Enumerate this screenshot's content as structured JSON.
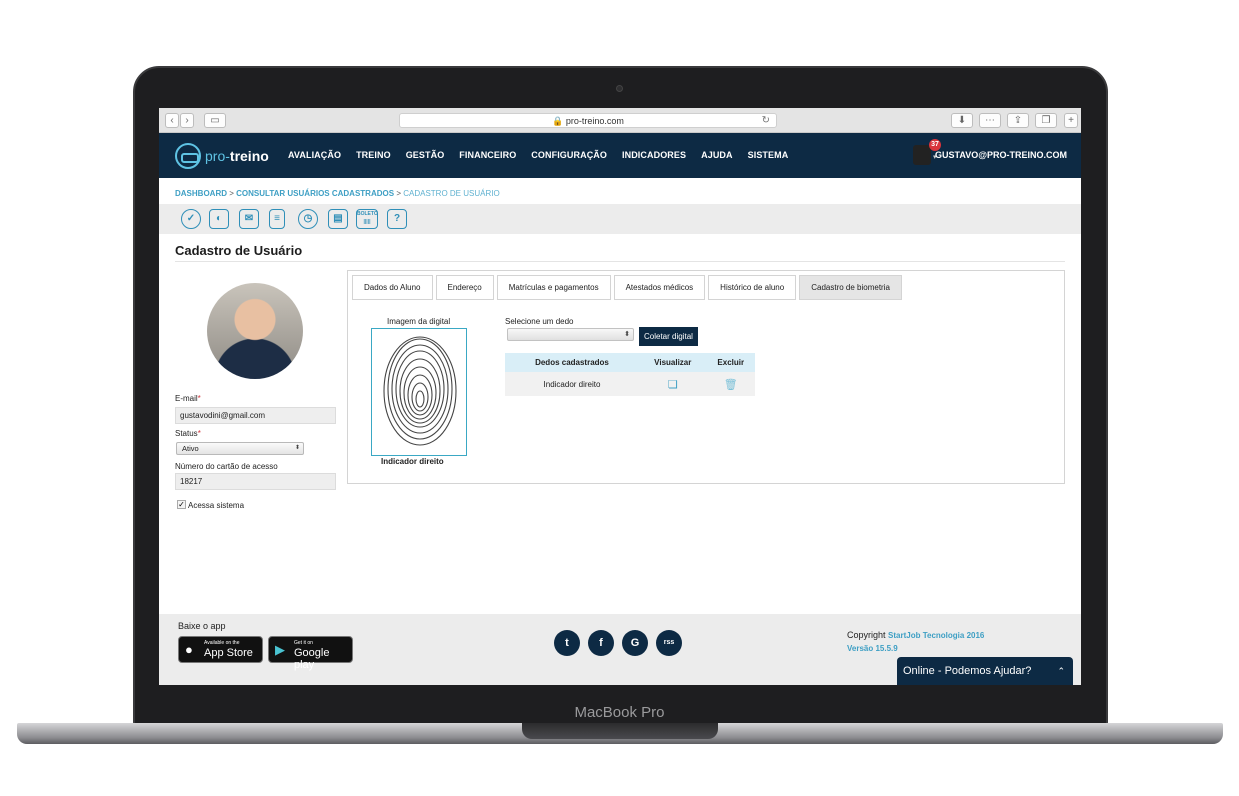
{
  "device": {
    "brand": "MacBook Pro"
  },
  "browser": {
    "url": "pro-treino.com",
    "back": "‹",
    "forward": "›"
  },
  "nav": {
    "logo_prefix": "pro-",
    "logo_name": "treino",
    "menu": [
      "AVALIAÇÃO",
      "TREINO",
      "GESTÃO",
      "FINANCEIRO",
      "CONFIGURAÇÃO",
      "INDICADORES",
      "AJUDA",
      "SISTEMA"
    ],
    "notifications": "37",
    "user": "GUSTAVO@PRO-TREINO.COM"
  },
  "breadcrumb": {
    "items": [
      "DASHBOARD",
      "CONSULTAR USUÁRIOS CADASTRADOS",
      "CADASTRO DE USUÁRIO"
    ],
    "separator": ">"
  },
  "toolbar": {
    "boleto_label": "BOLETO",
    "help_label": "?"
  },
  "page_title": "Cadastro de Usuário",
  "profile": {
    "email_label": "E-mail",
    "email": "gustavodini@gmail.com",
    "status_label": "Status",
    "status": "Ativo",
    "card_label": "Número do cartão de acesso",
    "card": "18217",
    "access_label": "Acessa sistema",
    "access_checked": true,
    "required_mark": "*"
  },
  "tabs": [
    {
      "label": "Dados do Aluno"
    },
    {
      "label": "Endereço"
    },
    {
      "label": "Matrículas e pagamentos"
    },
    {
      "label": "Atestados médicos"
    },
    {
      "label": "Histórico de aluno"
    },
    {
      "label": "Cadastro de biometria"
    }
  ],
  "biometria": {
    "image_label": "Imagem da digital",
    "finger_name": "Indicador direito",
    "select_label": "Selecione um dedo",
    "collect_button": "Coletar digital",
    "table": {
      "headers": [
        "Dedos cadastrados",
        "Visualizar",
        "Excluir"
      ],
      "rows": [
        {
          "finger": "Indicador direito"
        }
      ]
    }
  },
  "footer": {
    "app_label": "Baixe o app",
    "appstore_small": "Available on the",
    "appstore_big": "App Store",
    "googleplay_small": "Get it on",
    "googleplay_big": "Google play",
    "social": [
      "t",
      "f",
      "G",
      "rss"
    ],
    "copyright_label": "Copyright",
    "copyright_company": "StartJob Tecnologia 2016",
    "version": "Versão 15.5.9"
  },
  "chat": {
    "label": "Online - Podemos Ajudar?"
  },
  "colors": {
    "nav": "#0d2a44",
    "accent": "#3e9fc4",
    "required": "#d0343b"
  }
}
